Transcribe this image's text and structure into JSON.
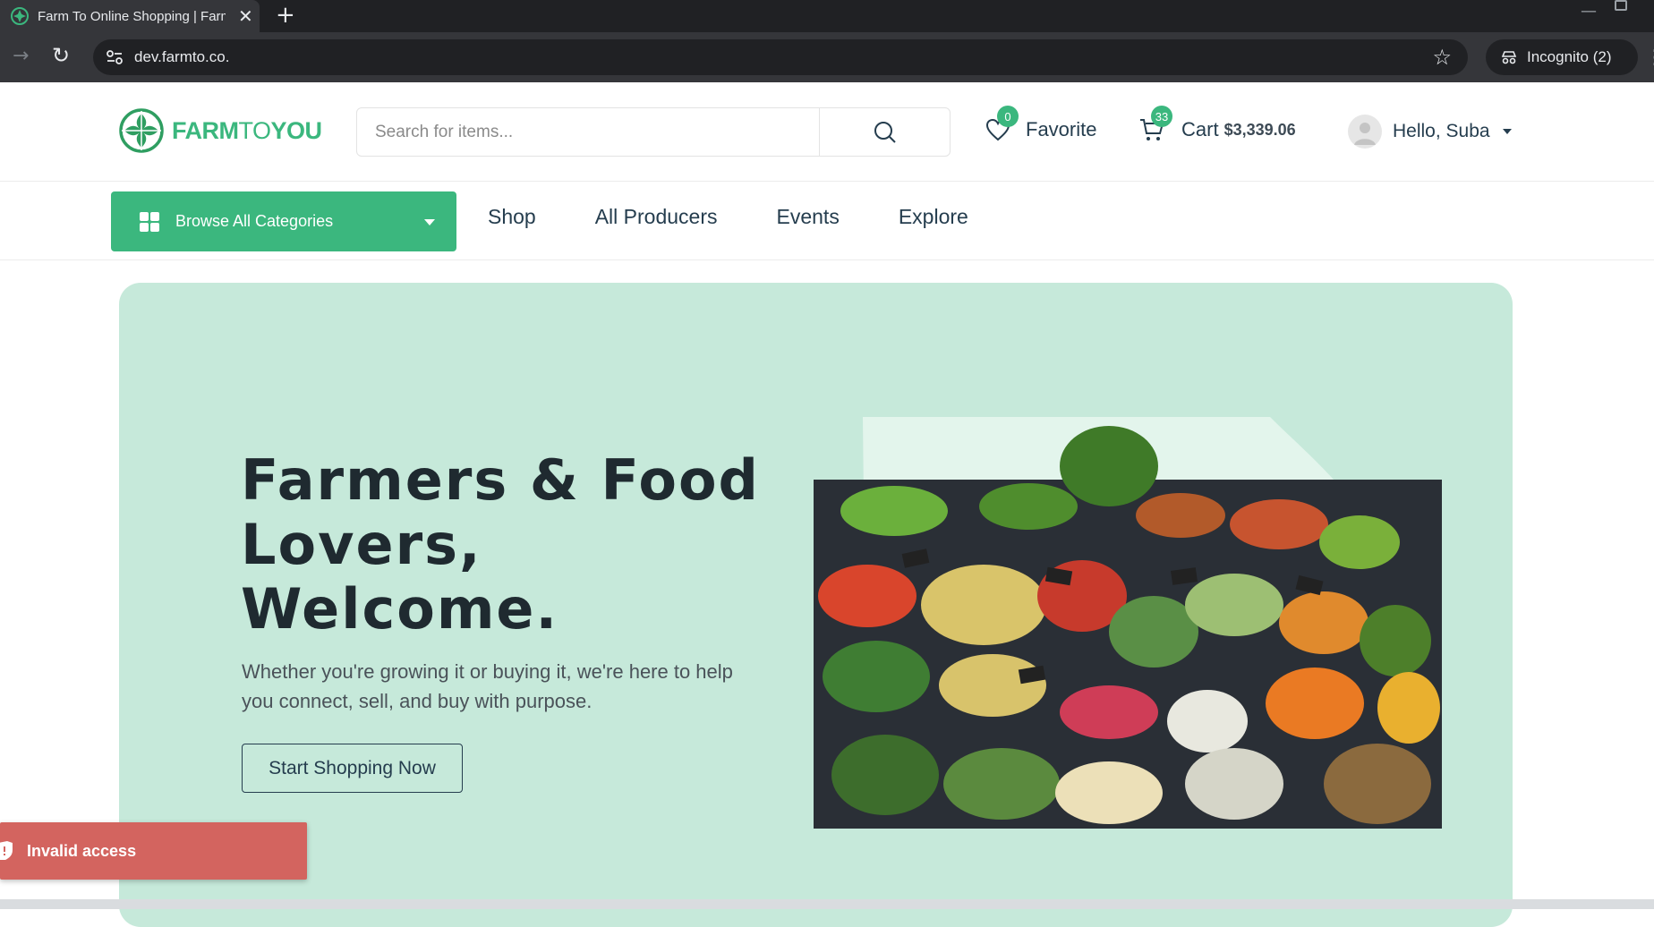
{
  "browser": {
    "tab_title": "Farm To Online Shopping | Farm",
    "tab_close": "✕",
    "new_tab": "+",
    "url": "dev.farmto.co.",
    "incognito_label": "Incognito (2)"
  },
  "header": {
    "logo_primary": "FARM",
    "logo_to": "TO",
    "logo_secondary": "YOU",
    "search_placeholder": "Search for items...",
    "favorite_label": "Favorite",
    "favorite_count": "0",
    "cart_label": "Cart",
    "cart_count": "33",
    "cart_total": "$3,339.06",
    "user_greeting": "Hello, Suba"
  },
  "nav": {
    "browse_label": "Browse All Categories",
    "links": [
      "Shop",
      "All Producers",
      "Events",
      "Explore"
    ]
  },
  "hero": {
    "title_line1": "Farmers & Food",
    "title_line2": "Lovers,",
    "title_line3": "Welcome.",
    "subtitle": "Whether you're growing it or buying it, we're here to help you connect, sell, and buy with purpose.",
    "cta_label": "Start Shopping Now"
  },
  "toast": {
    "message": "Invalid access"
  },
  "icons": {
    "search": "search-icon",
    "heart": "heart-icon",
    "cart": "cart-icon",
    "grid": "grid-icon",
    "shield": "shield-icon"
  },
  "colors": {
    "brand_green": "#3bb77e",
    "hero_bg": "#c6e9da",
    "toast_bg": "#d3645f",
    "text_dark": "#253d4e"
  }
}
